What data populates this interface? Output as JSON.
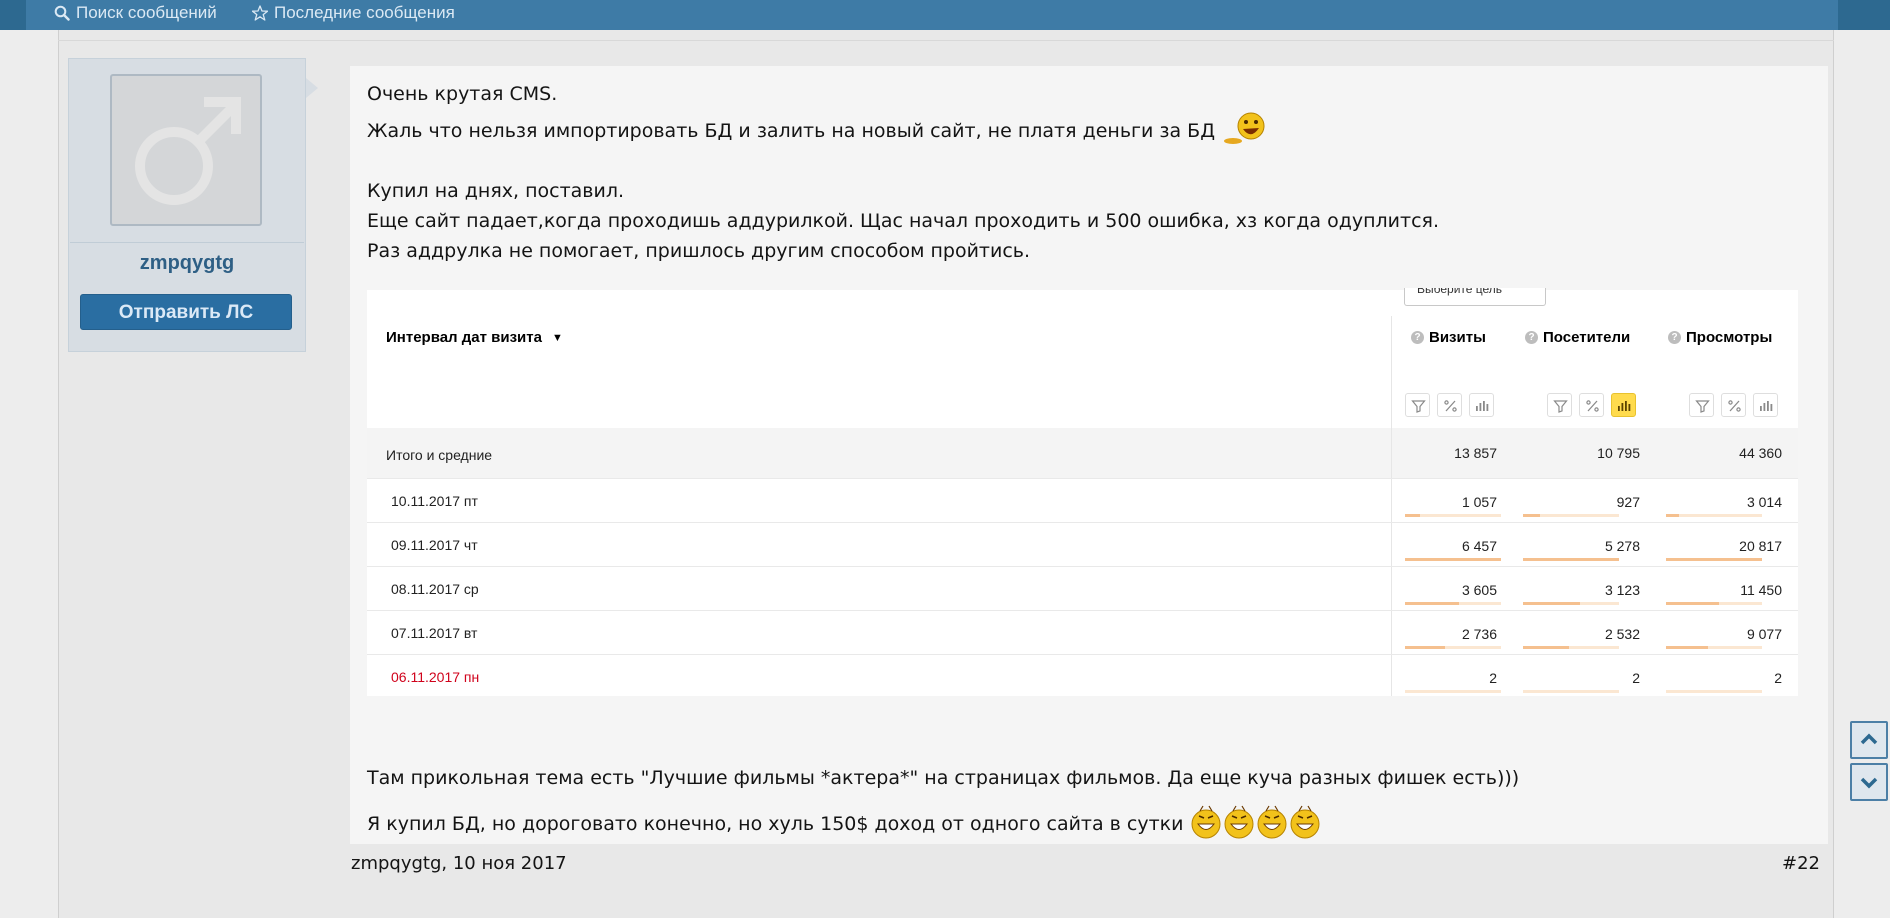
{
  "topnav": {
    "search_label": "Поиск сообщений",
    "recent_label": "Последние сообщения",
    "search_icon": "search-icon",
    "recent_icon": "star-icon"
  },
  "user": {
    "name": "zmpqygtg",
    "pm_button": "Отправить ЛС",
    "avatar_icon": "male-symbol-icon"
  },
  "message": {
    "lines": [
      "Очень крутая CMS.",
      "Жаль что нельзя импортировать БД и залить на новый сайт, не платя деньги за БД",
      "Купил на днях, поставил.",
      "Еще сайт падает,когда проходишь аддурилкой. Щас начал проходить и 500 ошибка, хз когда одуплится.",
      "Раз аддрулка не помогает, пришлось другим способом пройтись.",
      "Там прикольная тема есть \"Лучшие фильмы *актера*\" на страницах фильмов. Да еще куча разных фишек есть)))",
      "Я купил БД, но дороговато конечно, но хуль 150$ доход от одного сайта в сутки"
    ]
  },
  "stats_table": {
    "goal_select": "Выберите цель",
    "interval_header": "Интервал дат визита",
    "columns": [
      "Визиты",
      "Посетители",
      "Просмотры"
    ],
    "active_tool_column": 1,
    "totals_label": "Итого и средние",
    "totals": [
      "13 857",
      "10 795",
      "44 360"
    ],
    "rows": [
      {
        "date": "10.11.2017 пт",
        "weekend": false,
        "values": [
          "1 057",
          "927",
          "3 014"
        ],
        "shares": [
          0.16,
          0.18,
          0.14
        ]
      },
      {
        "date": "09.11.2017 чт",
        "weekend": false,
        "values": [
          "6 457",
          "5 278",
          "20 817"
        ],
        "shares": [
          1.0,
          1.0,
          1.0
        ]
      },
      {
        "date": "08.11.2017 ср",
        "weekend": false,
        "values": [
          "3 605",
          "3 123",
          "11 450"
        ],
        "shares": [
          0.56,
          0.59,
          0.55
        ]
      },
      {
        "date": "07.11.2017 вт",
        "weekend": false,
        "values": [
          "2 736",
          "2 532",
          "9 077"
        ],
        "shares": [
          0.42,
          0.48,
          0.44
        ]
      },
      {
        "date": "06.11.2017 пн",
        "weekend": true,
        "values": [
          "2",
          "2",
          "2"
        ],
        "shares": [
          0.0,
          0.0,
          0.0
        ]
      }
    ]
  },
  "post": {
    "meta": "zmpqygtg, 10 ноя 2017",
    "number": "#22"
  },
  "colors": {
    "nav_bg": "#3e7ba6",
    "button_bg": "#2a6ea2",
    "username": "#2e5f85",
    "bar_fill": "#f5c08f",
    "bar_track": "#fbe7d2",
    "weekend_text": "#d0021b",
    "active_tool": "#ffdb4d"
  }
}
